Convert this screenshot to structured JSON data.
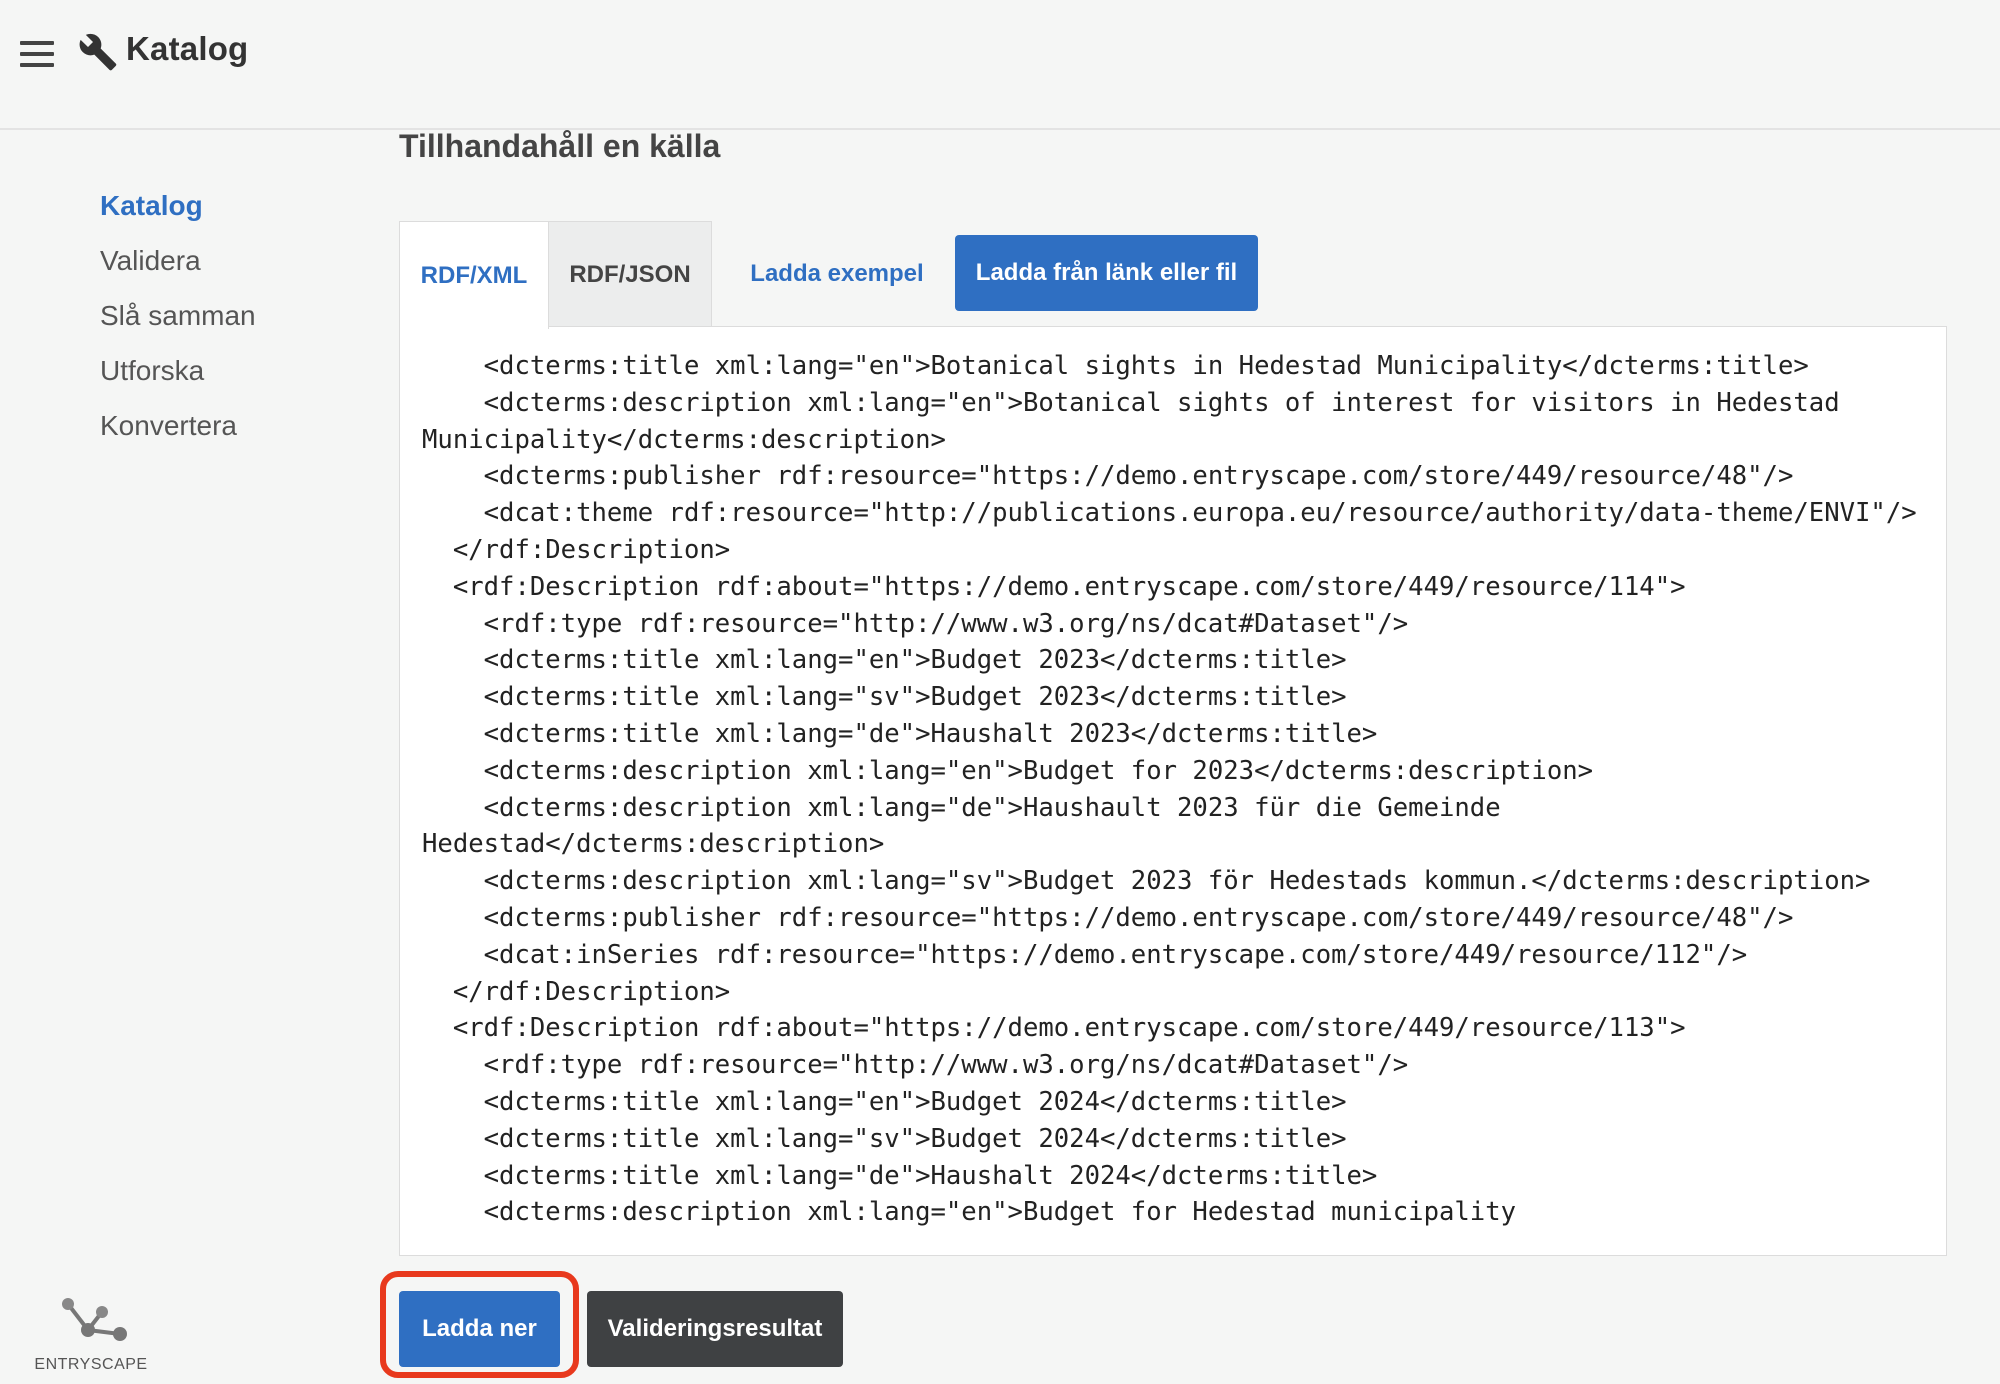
{
  "header": {
    "title": "Katalog",
    "menu_icon": "hamburger-menu-icon",
    "app_icon": "wrench-icon"
  },
  "sidebar": {
    "items": [
      {
        "label": "Katalog",
        "active": true
      },
      {
        "label": "Validera",
        "active": false
      },
      {
        "label": "Slå samman",
        "active": false
      },
      {
        "label": "Utforska",
        "active": false
      },
      {
        "label": "Konvertera",
        "active": false
      }
    ]
  },
  "main": {
    "title": "Tillhandahåll en källa",
    "tabs": [
      {
        "label": "RDF/XML",
        "active": true
      },
      {
        "label": "RDF/JSON",
        "active": false
      }
    ],
    "load_example_label": "Ladda exempel",
    "load_link_label": "Ladda från länk eller fil",
    "code_lines": [
      "    <dcterms:title xml:lang=\"en\">Botanical sights in Hedestad Municipality</dcterms:title>",
      "    <dcterms:description xml:lang=\"en\">Botanical sights of interest for visitors in Hedestad",
      "Municipality</dcterms:description>",
      "    <dcterms:publisher rdf:resource=\"https://demo.entryscape.com/store/449/resource/48\"/>",
      "    <dcat:theme rdf:resource=\"http://publications.europa.eu/resource/authority/data-theme/ENVI\"/>",
      "  </rdf:Description>",
      "  <rdf:Description rdf:about=\"https://demo.entryscape.com/store/449/resource/114\">",
      "    <rdf:type rdf:resource=\"http://www.w3.org/ns/dcat#Dataset\"/>",
      "    <dcterms:title xml:lang=\"en\">Budget 2023</dcterms:title>",
      "    <dcterms:title xml:lang=\"sv\">Budget 2023</dcterms:title>",
      "    <dcterms:title xml:lang=\"de\">Haushalt 2023</dcterms:title>",
      "    <dcterms:description xml:lang=\"en\">Budget for 2023</dcterms:description>",
      "    <dcterms:description xml:lang=\"de\">Haushault 2023 für die Gemeinde",
      "Hedestad</dcterms:description>",
      "    <dcterms:description xml:lang=\"sv\">Budget 2023 för Hedestads kommun.</dcterms:description>",
      "    <dcterms:publisher rdf:resource=\"https://demo.entryscape.com/store/449/resource/48\"/>",
      "    <dcat:inSeries rdf:resource=\"https://demo.entryscape.com/store/449/resource/112\"/>",
      "  </rdf:Description>",
      "  <rdf:Description rdf:about=\"https://demo.entryscape.com/store/449/resource/113\">",
      "    <rdf:type rdf:resource=\"http://www.w3.org/ns/dcat#Dataset\"/>",
      "    <dcterms:title xml:lang=\"en\">Budget 2024</dcterms:title>",
      "    <dcterms:title xml:lang=\"sv\">Budget 2024</dcterms:title>",
      "    <dcterms:title xml:lang=\"de\">Haushalt 2024</dcterms:title>",
      "    <dcterms:description xml:lang=\"en\">Budget for Hedestad municipality"
    ],
    "download_label": "Ladda ner",
    "validation_label": "Valideringsresultat"
  },
  "footer": {
    "logo_text": "ENTRYSCAPE"
  },
  "colors": {
    "accent": "#2f6fc2",
    "dark_button": "#3f4143",
    "highlight": "#e8391d"
  }
}
